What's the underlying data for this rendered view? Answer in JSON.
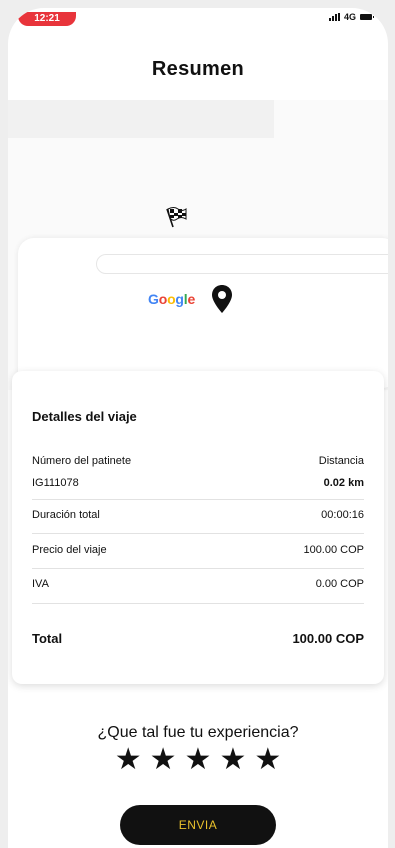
{
  "status_bar": {
    "time": "12:21",
    "network": "4G"
  },
  "header": {
    "title": "Resumen"
  },
  "map": {
    "provider_logo": "Google",
    "icons": [
      "checkered-flag-icon",
      "location-pin-icon"
    ]
  },
  "trip_details": {
    "title": "Detalles del viaje",
    "scooter_label": "Número del patinete",
    "scooter_value": "IG111078",
    "distance_label": "Distancia",
    "distance_value": "0.02 km",
    "duration_label": "Duración total",
    "duration_value": "00:00:16",
    "price_label": "Precio del viaje",
    "price_value": "100.00 COP",
    "tax_label": "IVA",
    "tax_value": "0.00 COP",
    "total_label": "Total",
    "total_value": "100.00 COP"
  },
  "rating": {
    "question": "¿Que tal fue tu experiencia?",
    "stars": [
      "★",
      "★",
      "★",
      "★",
      "★"
    ],
    "max": 5
  },
  "actions": {
    "send_label": "ENVIA"
  },
  "colors": {
    "send_button_bg": "#111111",
    "send_button_text": "#e9c12c",
    "status_pill": "#e8343b"
  }
}
